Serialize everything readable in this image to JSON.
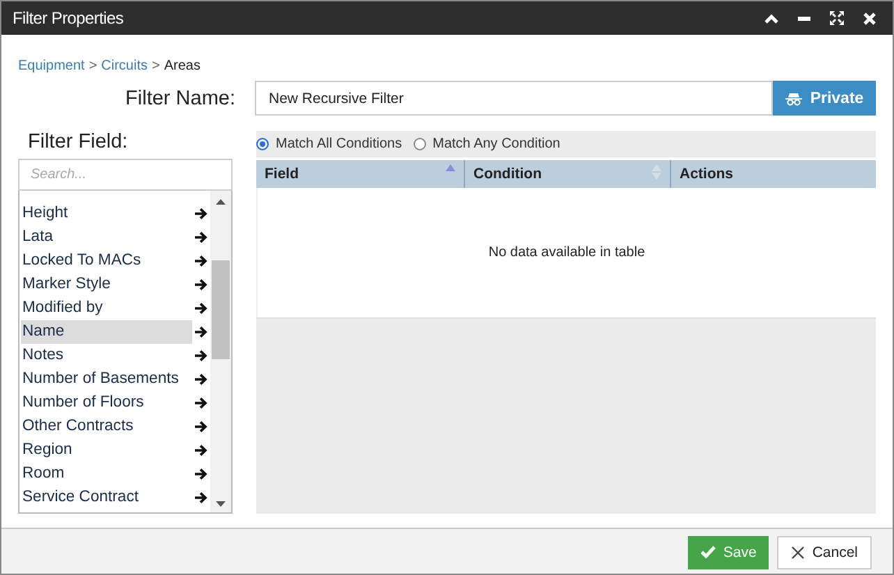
{
  "window": {
    "title": "Filter Properties"
  },
  "breadcrumb": [
    {
      "label": "Equipment",
      "link": true
    },
    {
      "label": "Circuits",
      "link": true
    },
    {
      "label": "Areas",
      "link": false
    }
  ],
  "breadcrumb_separator": ">",
  "filter_name": {
    "label": "Filter Name:",
    "value": "New Recursive Filter",
    "button": "Private"
  },
  "filter_field": {
    "label": "Filter Field:",
    "placeholder": "Search...",
    "items": [
      {
        "label": "Height",
        "selected": false
      },
      {
        "label": "Lata",
        "selected": false
      },
      {
        "label": "Locked To MACs",
        "selected": false
      },
      {
        "label": "Marker Style",
        "selected": false
      },
      {
        "label": "Modified by",
        "selected": false
      },
      {
        "label": "Name",
        "selected": true
      },
      {
        "label": "Notes",
        "selected": false
      },
      {
        "label": "Number of Basements",
        "selected": false
      },
      {
        "label": "Number of Floors",
        "selected": false
      },
      {
        "label": "Other Contracts",
        "selected": false
      },
      {
        "label": "Region",
        "selected": false
      },
      {
        "label": "Room",
        "selected": false
      },
      {
        "label": "Service Contract",
        "selected": false
      }
    ]
  },
  "match_options": [
    {
      "label": "Match All Conditions",
      "selected": true
    },
    {
      "label": "Match Any Condition",
      "selected": false
    }
  ],
  "table": {
    "columns": [
      {
        "label": "Field",
        "sortable": true,
        "sorted": true
      },
      {
        "label": "Condition",
        "sortable": true,
        "sorted": false
      },
      {
        "label": "Actions",
        "sortable": false
      }
    ],
    "empty_message": "No data available in table"
  },
  "buttons": [
    {
      "label": "Save",
      "kind": "primary"
    },
    {
      "label": "Cancel",
      "kind": "secondary"
    }
  ]
}
